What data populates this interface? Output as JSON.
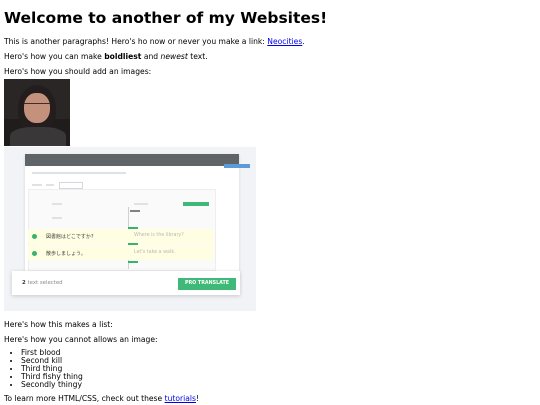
{
  "heading": "Welcome to another of my Websites!",
  "intro": {
    "text": "This is another paragraphs! Hero's ho now or never you make a link: ",
    "link": "Neocities",
    "after": "."
  },
  "formatting": {
    "before": "Hero's how you can make ",
    "bold": "boldliest",
    "middle": " and ",
    "italic": "newest",
    "after": " text."
  },
  "images_intro": "Hero's how you should add an images:",
  "screenshot": {
    "rows": [
      {
        "jp": "図書館はどこですか?",
        "en": "Where is the library?"
      },
      {
        "jp": "散歩しましょう。",
        "en": "Let's take a walk."
      }
    ],
    "selected_count": "2",
    "selected_label": " text selected",
    "button_label": "PRO TRANSLATE",
    "accent_color": "#3fb978"
  },
  "list_intro": "Here's how this makes a list:",
  "image_note": "Here's how you cannot allows an image:",
  "list_items": [
    "First blood",
    "Second kill",
    "Third thing",
    "Third fishy thing",
    "Secondly thingy"
  ],
  "outro": {
    "text": "To learn more HTML/CSS, check out these ",
    "link": "tutorials",
    "after": "!"
  }
}
